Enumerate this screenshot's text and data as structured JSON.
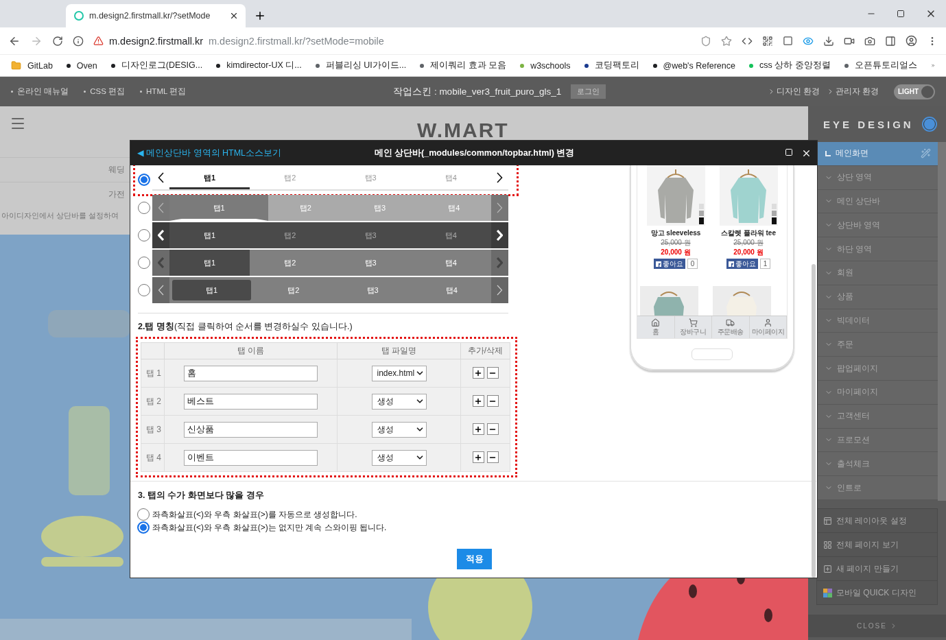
{
  "browser": {
    "tab_title": "m.design2.firstmall.kr/?setMode",
    "url_host": "m.design2.firstmall.kr",
    "url_full": "m.design2.firstmall.kr/?setMode=mobile",
    "bookmarks": [
      {
        "label": "GitLab",
        "kind": "folder"
      },
      {
        "label": "Oven",
        "kind": "site",
        "color": "#202124"
      },
      {
        "label": "디자인로그(DESIG...",
        "kind": "site",
        "color": "#202124"
      },
      {
        "label": "kimdirector-UX 디...",
        "kind": "site",
        "color": "#202124"
      },
      {
        "label": "퍼블리싱 UI가이드...",
        "kind": "site",
        "color": "#5f6368"
      },
      {
        "label": "제이쿼리 효과 모음",
        "kind": "site",
        "color": "#5f6368"
      },
      {
        "label": "w3schools",
        "kind": "site",
        "color": "#7cb342"
      },
      {
        "label": "코딩팩토리",
        "kind": "site",
        "color": "#1a3a8f"
      },
      {
        "label": "@web's Reference",
        "kind": "site",
        "color": "#202124"
      },
      {
        "label": "css 상하 중앙정렬",
        "kind": "site",
        "color": "#14c25a"
      },
      {
        "label": "오픈튜토리얼스",
        "kind": "site",
        "color": "#5f6368"
      }
    ]
  },
  "admin_bar": {
    "left_links": [
      "온라인 매뉴얼",
      "CSS 편집",
      "HTML 편집"
    ],
    "skin": "작업스킨 : mobile_ver3_fruit_puro_gls_1",
    "login": "로그인",
    "right_links": [
      "디자인 환경",
      "관리자 환경"
    ],
    "theme_toggle": {
      "label": "LIGHT",
      "on": true
    }
  },
  "page": {
    "logo": "W.MART",
    "rows": [
      "웨딩",
      "가전"
    ],
    "notice": "아이디자인에서 상단바를 설정하여"
  },
  "modal": {
    "source_link": "◀ 메인상단바 영역의 HTML소스보기",
    "title": "메인 상단바(_modules/common/topbar.html) 변경",
    "styles": [
      {
        "kind": "underline",
        "selected": true,
        "tabs": [
          {
            "label": "탭1",
            "selected": true
          },
          {
            "label": "탭2",
            "selected": false
          },
          {
            "label": "탭3",
            "selected": false
          },
          {
            "label": "탭4",
            "selected": false
          }
        ]
      },
      {
        "kind": "graybar",
        "selected": false,
        "tabs": [
          {
            "label": "탭1",
            "selected": true
          },
          {
            "label": "탭2",
            "selected": false
          },
          {
            "label": "탭3",
            "selected": false
          },
          {
            "label": "탭4",
            "selected": false
          }
        ]
      },
      {
        "kind": "dark",
        "selected": false,
        "tabs": [
          {
            "label": "탭1",
            "selected": true
          },
          {
            "label": "탭2",
            "selected": false
          },
          {
            "label": "탭3",
            "selected": false
          },
          {
            "label": "탭4",
            "selected": false
          }
        ]
      },
      {
        "kind": "block",
        "selected": false,
        "tabs": [
          {
            "label": "탭1",
            "selected": true
          },
          {
            "label": "탭2",
            "selected": false
          },
          {
            "label": "탭3",
            "selected": false
          },
          {
            "label": "탭4",
            "selected": false
          }
        ]
      },
      {
        "kind": "pill",
        "selected": false,
        "tabs": [
          {
            "label": "탭1",
            "selected": true
          },
          {
            "label": "탭2",
            "selected": false
          },
          {
            "label": "탭3",
            "selected": false
          },
          {
            "label": "탭4",
            "selected": false
          }
        ]
      }
    ],
    "names_heading": "**2.탭 명칭**(직접 클릭하여 순서를 변경하실수 있습니다.)",
    "columns": [
      "탭 이름",
      "탭 파일명",
      "추가/삭제"
    ],
    "rows": [
      {
        "label": "탭 1",
        "name": "홈",
        "file": "index.html"
      },
      {
        "label": "탭 2",
        "name": "베스트",
        "file": "생성"
      },
      {
        "label": "탭 3",
        "name": "신상품",
        "file": "생성"
      },
      {
        "label": "탭 4",
        "name": "이벤트",
        "file": "생성"
      }
    ],
    "overflow_heading": "3. 탭의 수가 화면보다 많을 경우",
    "overflow_options": [
      {
        "label": "좌측화살표(<)와 우측 화살표(>)를 자동으로 생성합니다.",
        "selected": false
      },
      {
        "label": "좌측화살표(<)와 우측 화살표(>)는 없지만 계속 스와이핑 됩니다.",
        "selected": true
      }
    ],
    "apply": "적용"
  },
  "preview": {
    "products": [
      {
        "name": "망고 sleeveless",
        "old_price": "25,000 원",
        "price": "20,000 원",
        "like": "좋아요",
        "likes": "0"
      },
      {
        "name": "스칼렛 플라워 tee",
        "old_price": "25,000 원",
        "price": "20,000 원",
        "like": "좋아요",
        "likes": "1"
      }
    ],
    "nav": [
      "홈",
      "장바구니",
      "주문배송",
      "마이페이지"
    ]
  },
  "sidebar": {
    "title": "EYE DESIGN",
    "toggle_on": true,
    "items": [
      {
        "label": "메인화면",
        "selected": true
      },
      {
        "label": "상단 영역",
        "selected": false
      },
      {
        "label": "메인 상단바",
        "selected": false
      },
      {
        "label": "상단바 영역",
        "selected": false
      },
      {
        "label": "하단 영역",
        "selected": false
      },
      {
        "label": "회원",
        "selected": false
      },
      {
        "label": "상품",
        "selected": false
      },
      {
        "label": "빅데이터",
        "selected": false
      },
      {
        "label": "주문",
        "selected": false
      },
      {
        "label": "팝업페이지",
        "selected": false
      },
      {
        "label": "마이페이지",
        "selected": false
      },
      {
        "label": "고객센터",
        "selected": false
      },
      {
        "label": "프로모션",
        "selected": false
      },
      {
        "label": "출석체크",
        "selected": false
      },
      {
        "label": "인트로",
        "selected": false
      }
    ],
    "actions": [
      {
        "label": "전체 레이아웃 설정",
        "kind": "layout"
      },
      {
        "label": "전체 페이지 보기",
        "kind": "pages"
      },
      {
        "label": "새 페이지 만들기",
        "kind": "new"
      },
      {
        "label": "모바일 QUICK 디자인",
        "kind": "quick"
      }
    ],
    "close": "CLOSE"
  }
}
